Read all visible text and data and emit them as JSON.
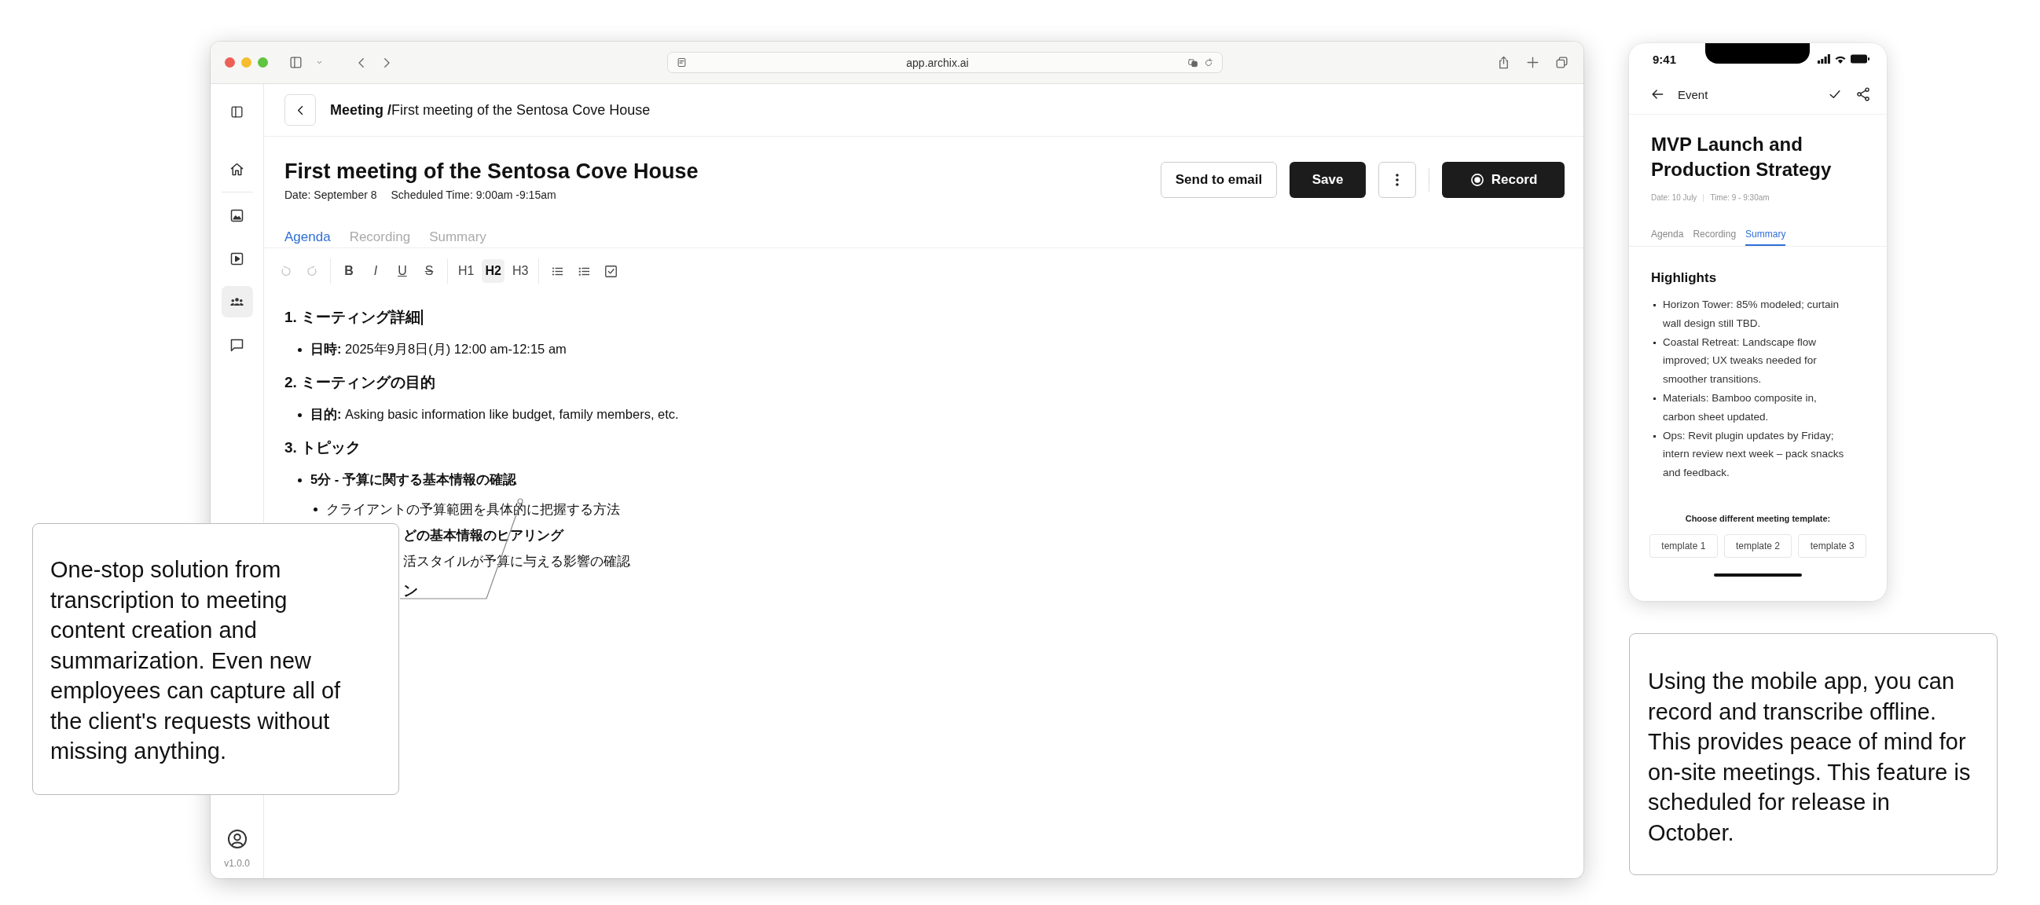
{
  "browser": {
    "url": "app.archix.ai"
  },
  "sidebar": {
    "items": [
      {
        "kind": "home",
        "selected": false
      },
      {
        "kind": "image",
        "selected": false
      },
      {
        "kind": "video",
        "selected": false
      },
      {
        "kind": "people",
        "selected": true
      },
      {
        "kind": "chat",
        "selected": false
      }
    ],
    "version": "v1.0.0"
  },
  "breadcrumb": "**Meeting /**First meeting of the Sentosa Cove House",
  "meeting": {
    "title": "First meeting of the Sentosa Cove House",
    "date": "Date: September 8",
    "scheduled": "Scheduled Time: 9:00am -9:15am"
  },
  "actions": [
    {
      "kind": "outline",
      "label": "Send to email"
    },
    {
      "kind": "primary",
      "label": "Save"
    },
    {
      "kind": "more"
    },
    {
      "kind": "record",
      "label": "Record"
    }
  ],
  "tabs": [
    {
      "label": "Agenda",
      "selected": true
    },
    {
      "label": "Recording",
      "selected": false
    },
    {
      "label": "Summary",
      "selected": false
    }
  ],
  "toolbar": [
    [
      {
        "kind": "undo",
        "disabled": true
      },
      {
        "kind": "redo",
        "disabled": true
      }
    ],
    [
      {
        "kind": "bold",
        "label": "B"
      },
      {
        "kind": "italic",
        "label": "I"
      },
      {
        "kind": "underline",
        "label": "U"
      },
      {
        "kind": "strike",
        "label": "S"
      }
    ],
    [
      {
        "kind": "heading",
        "label": "H1",
        "selected": false
      },
      {
        "kind": "heading",
        "label": "H2",
        "selected": true
      },
      {
        "kind": "heading",
        "label": "H3",
        "selected": false
      }
    ],
    [
      {
        "kind": "bullet-list"
      },
      {
        "kind": "dotted-list"
      },
      {
        "kind": "task-list"
      }
    ]
  ],
  "content": [
    {
      "kind": "h",
      "text": "1. ミーティング詳細",
      "caret": true
    },
    {
      "kind": "bullet",
      "text": "**日時:** 2025年9月8日(月) 12:00 am-12:15 am",
      "bold": false
    },
    {
      "kind": "h",
      "text": "2. ミーティングの目的",
      "caret": false
    },
    {
      "kind": "bullet",
      "text": "**目的:** Asking basic information like budget, family members, etc.",
      "bold": false
    },
    {
      "kind": "h",
      "text": "3. トピック",
      "caret": false
    },
    {
      "kind": "bullet",
      "text": "5分 - 予算に関する基本情報の確認",
      "bold": true
    },
    {
      "kind": "sub",
      "text": "クライアントの予算範囲を具体的に把握する方法",
      "bold": false
    },
    {
      "kind": "cut",
      "text": "どの基本情報のヒアリング",
      "bold": true
    },
    {
      "kind": "cut",
      "text": "活スタイルが予算に与える影響の確認",
      "bold": false
    },
    {
      "kind": "cut-h",
      "text": "ン"
    }
  ],
  "phone": {
    "time": "9:41",
    "header": "Event",
    "title": "MVP Launch and Production Strategy",
    "date": "Date: 10 July",
    "time_range": "Time: 9 - 9:30am",
    "tabs": [
      {
        "label": "Agenda",
        "selected": false
      },
      {
        "label": "Recording",
        "selected": false
      },
      {
        "label": "Summary",
        "selected": true
      }
    ],
    "section": "Highlights",
    "highlights": [
      "Horizon Tower: 85% modeled; curtain wall design still TBD.",
      "Coastal Retreat: Landscape flow improved; UX tweaks needed for smoother transitions.",
      "Materials: Bamboo composite in, carbon sheet updated.",
      "Ops: Revit plugin updates by Friday; intern review next week – pack snacks and feedback."
    ],
    "prompt": "Choose different meeting template:",
    "templates": [
      "template 1",
      "template 2",
      "template 3"
    ]
  },
  "callouts": [
    {
      "text": "One-stop solution from transcription to meeting content creation and summarization. Even new employees can capture all of the client's requests without missing anything."
    },
    {
      "text": "Using the mobile app, you can record and transcribe offline. This provides peace of mind for on-site meetings. This feature is scheduled for release in October."
    }
  ]
}
